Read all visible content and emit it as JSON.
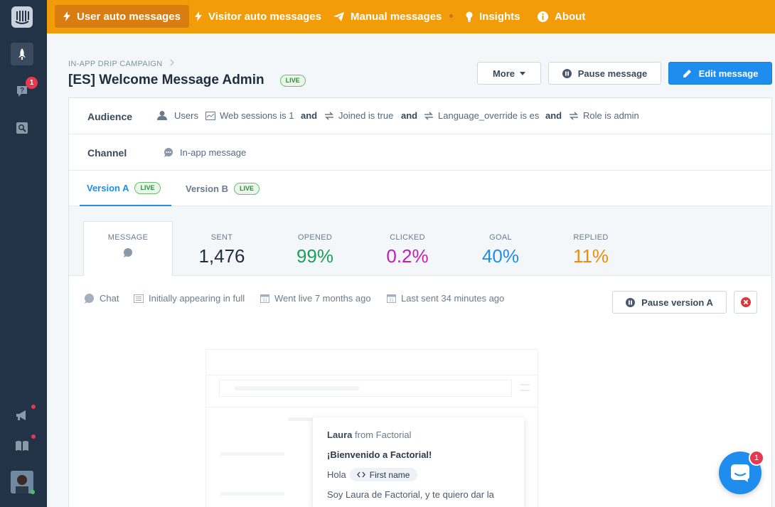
{
  "nav": {
    "items": [
      {
        "label": "User auto messages",
        "active": true
      },
      {
        "label": "Visitor auto messages"
      },
      {
        "label": "Manual messages"
      },
      {
        "label": "Insights"
      },
      {
        "label": "About"
      }
    ]
  },
  "sidebar": {
    "help_badge": "1"
  },
  "header": {
    "breadcrumb": "IN-APP DRIP CAMPAIGN",
    "title": "[ES] Welcome Message Admin",
    "status": "LIVE",
    "more_label": "More",
    "pause_label": "Pause message",
    "edit_label": "Edit message"
  },
  "audience": {
    "label": "Audience",
    "conditions": [
      "Users",
      "Web sessions is 1",
      "Joined is true",
      "Language_override is es",
      "Role is admin"
    ],
    "joiner": "and"
  },
  "channel": {
    "label": "Channel",
    "value": "In-app message"
  },
  "versions": [
    {
      "label": "Version A",
      "status": "LIVE",
      "active": true
    },
    {
      "label": "Version B",
      "status": "LIVE"
    }
  ],
  "stats": [
    {
      "label": "MESSAGE",
      "value": ""
    },
    {
      "label": "SENT",
      "value": "1,476",
      "color": "#1f2d3d"
    },
    {
      "label": "OPENED",
      "value": "99%",
      "color": "#18a05c"
    },
    {
      "label": "CLICKED",
      "value": "0.2%",
      "color": "#c21fb5"
    },
    {
      "label": "GOAL",
      "value": "40%",
      "color": "#1f8ded"
    },
    {
      "label": "REPLIED",
      "value": "11%",
      "color": "#f08c0a"
    }
  ],
  "meta": {
    "type": "Chat",
    "appearance": "Initially appearing in full",
    "went_live": "Went live 7 months ago",
    "last_sent": "Last sent 34 minutes ago",
    "pause_version": "Pause version A"
  },
  "preview": {
    "sender_name": "Laura",
    "sender_from": "from Factorial",
    "greeting_title": "¡Bienvenido a Factorial!",
    "hola": "Hola",
    "attribute": "First name",
    "body": "Soy Laura de Factorial, y te quiero dar la"
  },
  "launcher": {
    "badge": "1"
  },
  "colors": {
    "nav_bg": "#f39c0a",
    "sidebar_bg": "#233347",
    "primary": "#1f8ded",
    "live_green": "#2e8b3a"
  }
}
